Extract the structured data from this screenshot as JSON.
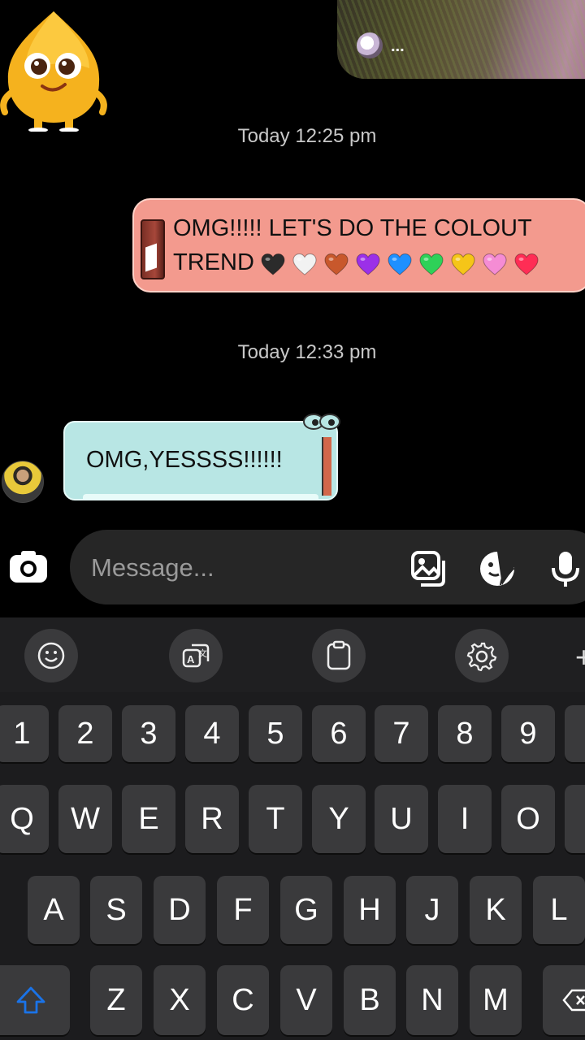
{
  "story": {
    "dots": "..."
  },
  "conversation": {
    "timestamp_1": "Today 12:25 pm",
    "outgoing_message": "OMG!!!!! LET'S DO THE COLOUT TREND",
    "hearts": [
      "#2b2b2b",
      "#f2f2f2",
      "#c8582c",
      "#9b30e8",
      "#1e90ff",
      "#2ed158",
      "#f5c518",
      "#f58cd4",
      "#ff2d55"
    ],
    "timestamp_2": "Today 12:33 pm",
    "incoming_message": "OMG,YESSSS!!!!!!"
  },
  "composer": {
    "placeholder": "Message...",
    "icons": [
      "camera-icon",
      "gallery-icon",
      "sticker-icon",
      "microphone-icon"
    ]
  },
  "keyboard": {
    "toolbar": [
      "emoji-icon",
      "translate-icon",
      "clipboard-icon",
      "settings-icon",
      "plus-icon"
    ],
    "toolbar_plus": "+",
    "row_numbers": [
      "1",
      "2",
      "3",
      "4",
      "5",
      "6",
      "7",
      "8",
      "9"
    ],
    "row_1": [
      "Q",
      "W",
      "E",
      "R",
      "T",
      "Y",
      "U",
      "I",
      "O"
    ],
    "row_2": [
      "A",
      "S",
      "D",
      "F",
      "G",
      "H",
      "J",
      "K",
      "L"
    ],
    "row_3": [
      "Z",
      "X",
      "C",
      "V",
      "B",
      "N",
      "M"
    ]
  },
  "colors": {
    "outgoing_bubble": "#f39a8e",
    "incoming_bubble": "#b8e6e4",
    "shift_accent": "#1a73e8"
  }
}
